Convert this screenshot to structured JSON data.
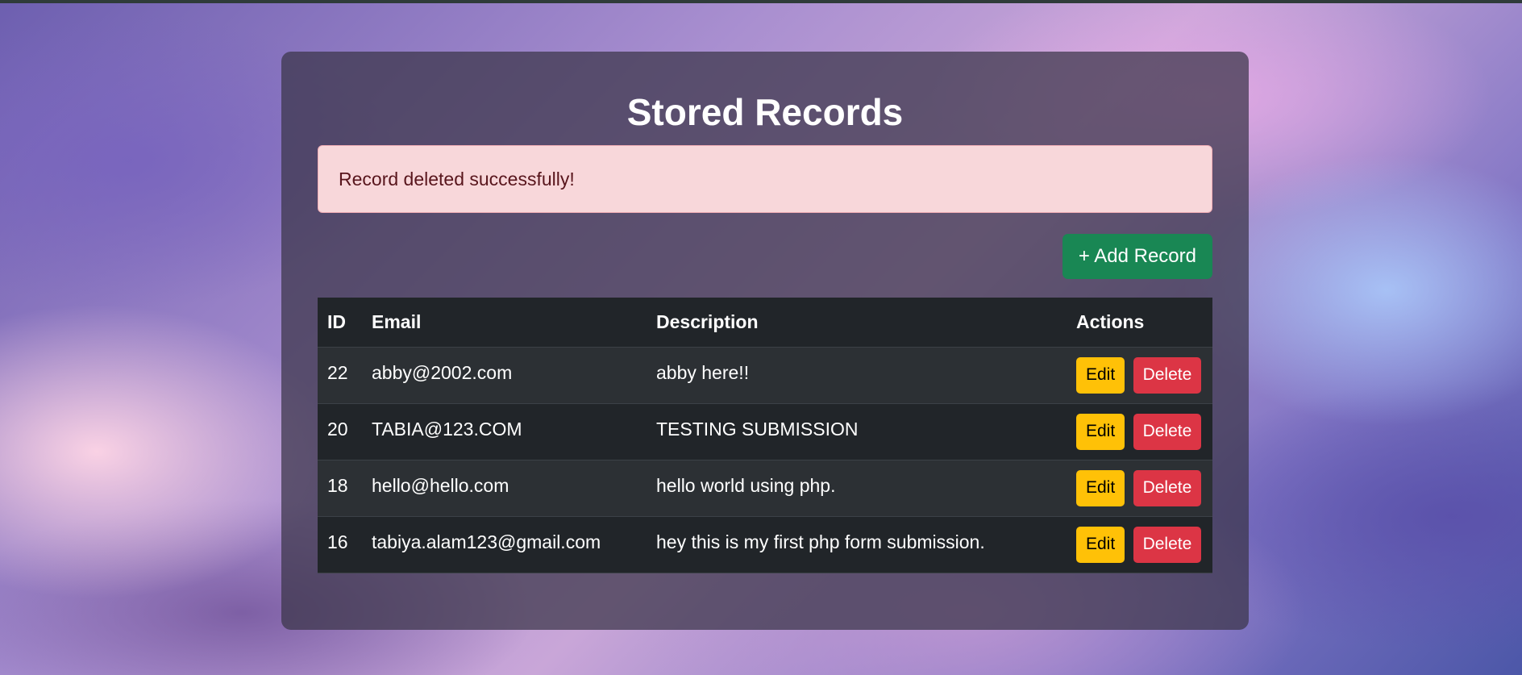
{
  "page": {
    "title": "Stored Records"
  },
  "alert": {
    "message": "Record deleted successfully!"
  },
  "toolbar": {
    "add_label": "+ Add Record"
  },
  "table": {
    "headers": {
      "id": "ID",
      "email": "Email",
      "description": "Description",
      "actions": "Actions"
    },
    "rows": [
      {
        "id": "22",
        "email": "abby@2002.com",
        "description": "abby here!!",
        "edit": "Edit",
        "delete": "Delete"
      },
      {
        "id": "20",
        "email": "TABIA@123.COM",
        "description": "TESTING SUBMISSION",
        "edit": "Edit",
        "delete": "Delete"
      },
      {
        "id": "18",
        "email": "hello@hello.com",
        "description": "hello world using php.",
        "edit": "Edit",
        "delete": "Delete"
      },
      {
        "id": "16",
        "email": "tabiya.alam123@gmail.com",
        "description": "hey this is my first php form submission.",
        "edit": "Edit",
        "delete": "Delete"
      }
    ]
  },
  "colors": {
    "add_button": "#198754",
    "edit_button": "#ffc107",
    "delete_button": "#dc3545",
    "alert_background": "#f8d7da",
    "table_dark": "#212529"
  }
}
